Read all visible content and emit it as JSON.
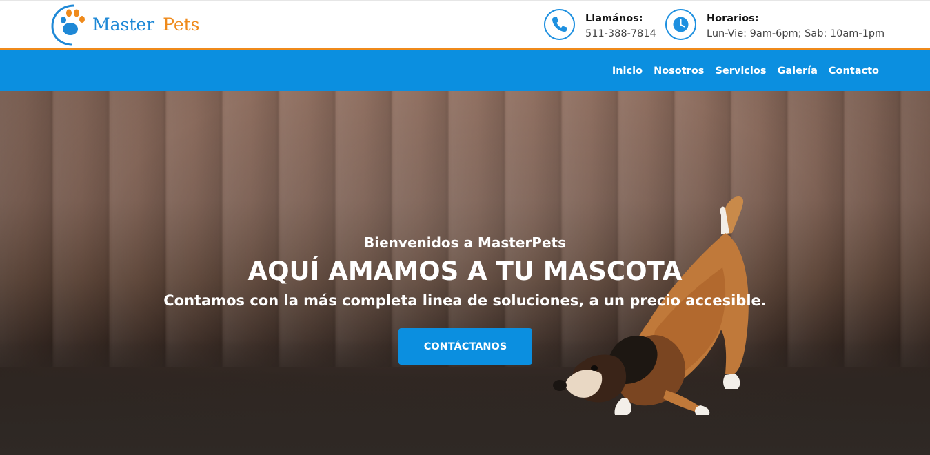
{
  "brand": {
    "word1": "Master",
    "word2": "Pets"
  },
  "header": {
    "phone": {
      "label": "Llamános:",
      "value": "511-388-7814",
      "icon": "phone-icon"
    },
    "hours": {
      "label": "Horarios:",
      "value": "Lun-Vie: 9am-6pm; Sab: 10am-1pm",
      "icon": "clock-icon"
    }
  },
  "nav": {
    "items": [
      "Inicio",
      "Nosotros",
      "Servicios",
      "Galería",
      "Contacto"
    ]
  },
  "hero": {
    "welcome": "Bienvenidos a MasterPets",
    "title": "AQUÍ AMAMOS A TU MASCOTA",
    "subtitle": "Contamos con la más completa linea de soluciones, a un precio accesible.",
    "cta": "CONTÁCTANOS"
  },
  "colors": {
    "accent_blue": "#0b8fe0",
    "accent_orange": "#ef8a1b",
    "logo_blue": "#1e88d6"
  }
}
